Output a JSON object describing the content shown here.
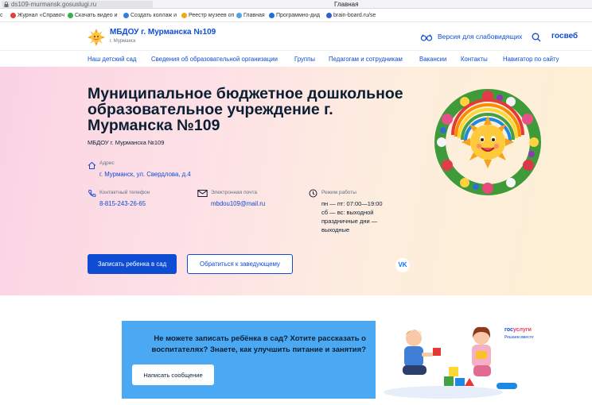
{
  "browser": {
    "url": "ds109-murmansk.gosuslugi.ru",
    "window_title": "Главная",
    "bookmarks": [
      {
        "label": "c",
        "color": "#9aa0a6"
      },
      {
        "label": "Журнал «Справоч",
        "color": "#e0413a"
      },
      {
        "label": "Скачать видео и",
        "color": "#36b24a"
      },
      {
        "label": "Создать коллаж и",
        "color": "#2f7fe0"
      },
      {
        "label": "Реестр музеев оп",
        "color": "#f2a81d"
      },
      {
        "label": "Главная",
        "color": "#53a3e8"
      },
      {
        "label": "Программно-дид",
        "color": "#1f6fd8"
      },
      {
        "label": "brain-board.ru/se",
        "color": "#2d62c8"
      }
    ]
  },
  "header": {
    "site_name": "МБДОУ г. Мурманска №109",
    "site_city": "г. Мурманск",
    "vision_link": "Версия для слабовидящих",
    "brand": "госвеб"
  },
  "nav": {
    "items": [
      "Наш детский сад",
      "Сведения об образовательной организации",
      "Группы",
      "Педагогам и сотрудникам",
      "Вакансии",
      "Контакты",
      "Навигатор по сайту"
    ]
  },
  "hero": {
    "title": "Муниципальное бюджетное дошкольное образовательное учреждение г. Мурманска №109",
    "short_name": "МБДОУ г. Мурманска №109",
    "address_label": "Адрес",
    "address_value": "г. Мурманск, ул. Свердлова, д.4",
    "phone_label": "Контактный телефон",
    "phone_value": "8-815-243-26-65",
    "email_label": "Электронная почта",
    "email_value": "mbdou109@mail.ru",
    "hours_label": "Режим работы",
    "hours_lines": [
      "пн — пт: 07:00—19:00",
      "сб — вс: выходной",
      "праздничные дни —",
      "выходные"
    ],
    "enroll_button": "Записать ребенка в сад",
    "contact_head_button": "Обратиться к заведующему",
    "vk_label": "VK"
  },
  "banner": {
    "text": "Не можете записать ребёнка в сад? Хотите рассказать о воспитателях? Знаете, как улучшить питание и занятия?",
    "button": "Написать сообщение",
    "logo_part1": "гос",
    "logo_part2": "услуги",
    "logo_sub": "Решаем вместе"
  },
  "colors": {
    "accent": "#0d4cd3",
    "banner_bg": "#4aa9f2",
    "vk": "#0077ff"
  }
}
